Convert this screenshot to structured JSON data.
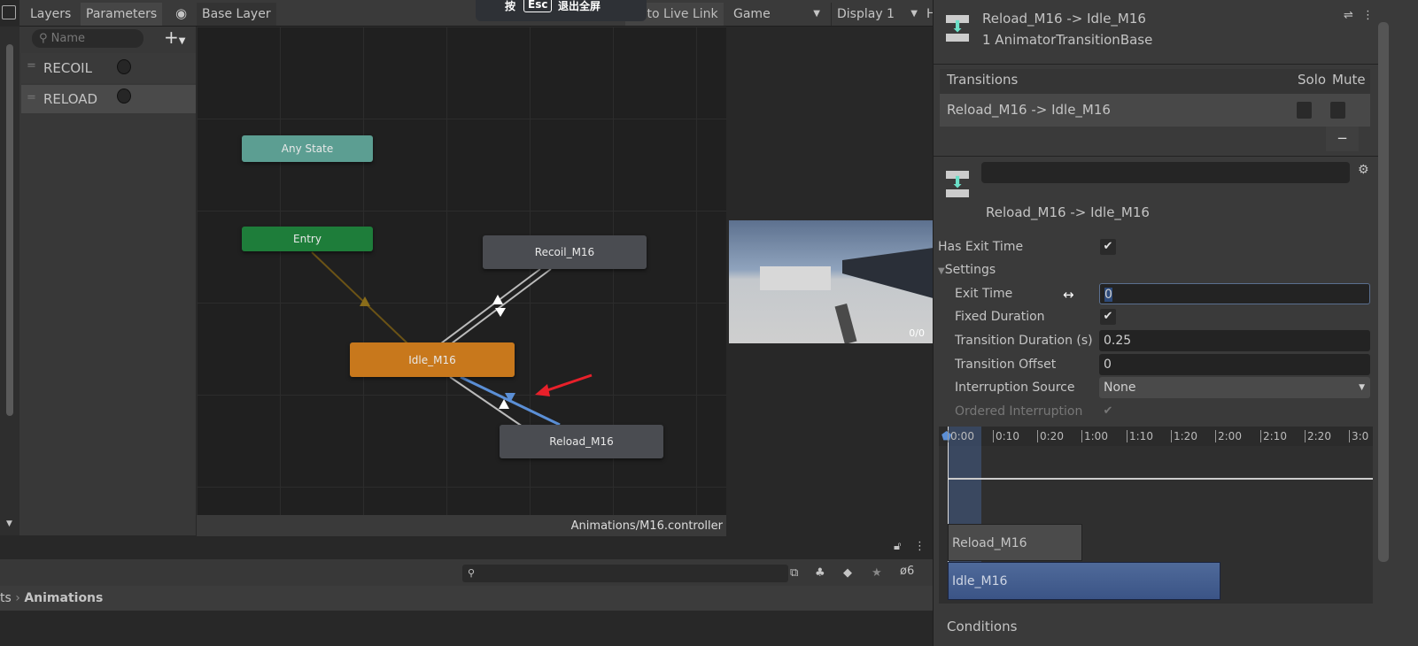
{
  "overlay": {
    "press": "按",
    "key": "Esc",
    "exit": "退出全屏"
  },
  "animator": {
    "tabs": [
      "Layers",
      "Parameters"
    ],
    "breadcrumb": "Base Layer",
    "auto_live_link": "Auto Live Link",
    "search_placeholder": "Name",
    "parameters": [
      {
        "name": "RECOIL",
        "type": "trigger"
      },
      {
        "name": "RELOAD",
        "type": "trigger"
      }
    ],
    "nodes": {
      "any_state": "Any State",
      "entry": "Entry",
      "recoil": "Recoil_M16",
      "idle": "Idle_M16",
      "reload": "Reload_M16"
    },
    "footer_path": "Animations/M16.controller",
    "colors": {
      "any_state": "#5c9e92",
      "entry": "#1e7d3a",
      "default_state": "#c8781c",
      "state": "#4a4c51",
      "selected_transition": "#5b8fd6"
    }
  },
  "game": {
    "tab": "Game",
    "display": "Display 1",
    "cut_tab": "H",
    "counter": "0/0"
  },
  "project": {
    "breadcrumb_prev": "ts",
    "breadcrumb_current": "Animations",
    "hidden_count": "6"
  },
  "inspector": {
    "title": "Reload_M16 -> Idle_M16",
    "subtitle": "1 AnimatorTransitionBase",
    "transitions_header": "Transitions",
    "solo": "Solo",
    "mute": "Mute",
    "transition_item": "Reload_M16 -> Idle_M16",
    "remove": "−",
    "name_field": "",
    "transition_name": "Reload_M16 -> Idle_M16",
    "has_exit_time": {
      "label": "Has Exit Time",
      "checked": true
    },
    "settings": "Settings",
    "exit_time": {
      "label": "Exit Time",
      "value": "0"
    },
    "fixed_duration": {
      "label": "Fixed Duration",
      "checked": true
    },
    "transition_duration": {
      "label": "Transition Duration (s)",
      "value": "0.25"
    },
    "transition_offset": {
      "label": "Transition Offset",
      "value": "0"
    },
    "interruption_source": {
      "label": "Interruption Source",
      "value": "None"
    },
    "ordered_interruption": {
      "label": "Ordered Interruption",
      "checked": true
    },
    "timeline_ticks": [
      "0:00",
      "0:10",
      "0:20",
      "1:00",
      "1:10",
      "1:20",
      "2:00",
      "2:10",
      "2:20",
      "3:0"
    ],
    "timeline_clips": [
      "Reload_M16",
      "Idle_M16"
    ],
    "conditions": "Conditions"
  }
}
